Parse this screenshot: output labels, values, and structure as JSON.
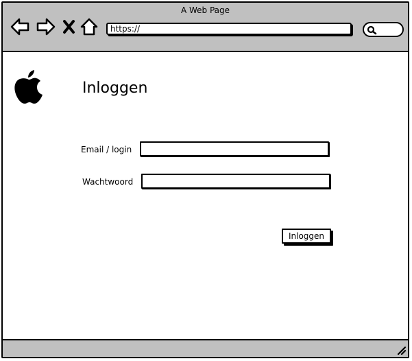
{
  "window": {
    "title": "A Web Page"
  },
  "browser": {
    "url": "https://",
    "icons": [
      "back-arrow-icon",
      "forward-arrow-icon",
      "close-icon",
      "home-icon",
      "search-icon"
    ]
  },
  "page": {
    "title": "Inloggen",
    "logo_icon": "apple-logo-icon",
    "form": {
      "email_label": "Email / login",
      "email_value": "",
      "password_label": "Wachtwoord",
      "password_value": "",
      "submit_label": "Inloggen"
    }
  }
}
